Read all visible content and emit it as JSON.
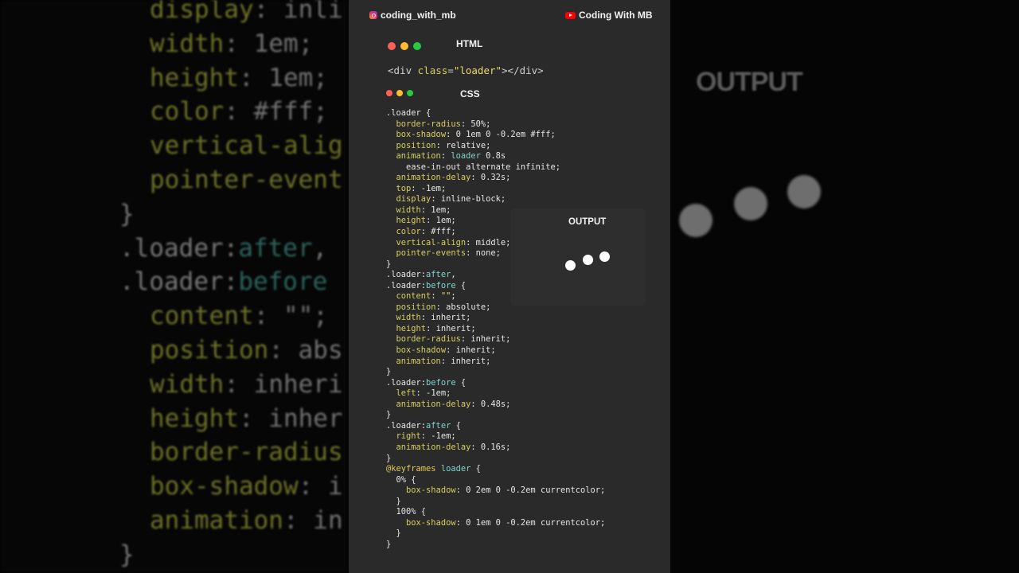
{
  "background_code_left": [
    {
      "prop": "display",
      "val": ": inli"
    },
    {
      "prop": "width",
      "val": ": 1em;"
    },
    {
      "prop": "height",
      "val": ": 1em;"
    },
    {
      "prop": "color",
      "val": ": #fff;"
    },
    {
      "prop": "vertical-alig",
      "val": ""
    },
    {
      "prop": "pointer-event",
      "val": ""
    },
    {
      "plain": "}"
    },
    {
      "sel": ".loader:",
      "pseudo": "after",
      "tail": ","
    },
    {
      "sel": ".loader:",
      "pseudo": "before",
      "tail": ""
    },
    {
      "prop": "content",
      "val": ": \"\";"
    },
    {
      "prop": "position",
      "val": ": abs"
    },
    {
      "prop": "width",
      "val": ": inheri"
    },
    {
      "prop": "height",
      "val": ": inher"
    },
    {
      "prop": "border-radius",
      "val": ""
    },
    {
      "prop": "box-shadow",
      "val": ": i"
    },
    {
      "prop": "animation",
      "val": ": in"
    },
    {
      "plain": "}"
    }
  ],
  "background_right": {
    "output_label": "OUTPUT"
  },
  "header": {
    "instagram_handle": "coding_with_mb",
    "youtube_channel": "Coding With MB"
  },
  "html_section": {
    "title": "HTML",
    "code": {
      "open": "<div ",
      "attr": "class",
      "eq": "=",
      "value": "\"loader\"",
      "close": "></div>"
    }
  },
  "css_section": {
    "title": "CSS",
    "lines": [
      {
        "indent": 0,
        "sel": ".loader",
        "tail": " {"
      },
      {
        "indent": 1,
        "prop": "border-radius",
        "val": ": 50%;"
      },
      {
        "indent": 1,
        "prop": "box-shadow",
        "val": ": 0 1em 0 -0.2em #fff;"
      },
      {
        "indent": 1,
        "prop": "position",
        "val": ": relative;"
      },
      {
        "indent": 1,
        "prop": "animation",
        "val": ": ",
        "valsel": "loader",
        "val2": " 0.8s"
      },
      {
        "indent": 2,
        "plain": "ease-in-out alternate infinite;"
      },
      {
        "indent": 1,
        "prop": "animation-delay",
        "val": ": 0.32s;"
      },
      {
        "indent": 1,
        "prop": "top",
        "val": ": -1em;"
      },
      {
        "indent": 1,
        "prop": "display",
        "val": ": inline-block;"
      },
      {
        "indent": 1,
        "prop": "width",
        "val": ": 1em;"
      },
      {
        "indent": 1,
        "prop": "height",
        "val": ": 1em;"
      },
      {
        "indent": 1,
        "prop": "color",
        "val": ": #fff;"
      },
      {
        "indent": 1,
        "prop": "vertical-align",
        "val": ": middle;"
      },
      {
        "indent": 1,
        "prop": "pointer-events",
        "val": ": none;"
      },
      {
        "indent": 0,
        "plain": "}"
      },
      {
        "indent": 0,
        "sel": ".loader:",
        "pseudo": "after",
        "tail": ","
      },
      {
        "indent": 0,
        "sel": ".loader:",
        "pseudo": "before",
        "tail": " {"
      },
      {
        "indent": 1,
        "prop": "content",
        "val": ": ",
        "valstr": "\"\"",
        "val2": ";"
      },
      {
        "indent": 1,
        "prop": "position",
        "val": ": absolute;"
      },
      {
        "indent": 1,
        "prop": "width",
        "val": ": inherit;"
      },
      {
        "indent": 1,
        "prop": "height",
        "val": ": inherit;"
      },
      {
        "indent": 1,
        "prop": "border-radius",
        "val": ": inherit;"
      },
      {
        "indent": 1,
        "prop": "box-shadow",
        "val": ": inherit;"
      },
      {
        "indent": 1,
        "prop": "animation",
        "val": ": inherit;"
      },
      {
        "indent": 0,
        "plain": "}"
      },
      {
        "indent": 0,
        "sel": ".loader:",
        "pseudo": "before",
        "tail": " {"
      },
      {
        "indent": 1,
        "prop": "left",
        "val": ": -1em;"
      },
      {
        "indent": 1,
        "prop": "animation-delay",
        "val": ": 0.48s;"
      },
      {
        "indent": 0,
        "plain": "}"
      },
      {
        "indent": 0,
        "sel": ".loader:",
        "pseudo": "after",
        "tail": " {"
      },
      {
        "indent": 1,
        "prop": "right",
        "val": ": -1em;"
      },
      {
        "indent": 1,
        "prop": "animation-delay",
        "val": ": 0.16s;"
      },
      {
        "indent": 0,
        "plain": "}"
      },
      {
        "indent": 0,
        "at": "@keyframes",
        "atname": " loader",
        "tail": " {"
      },
      {
        "indent": 1,
        "plain": "0% {"
      },
      {
        "indent": 2,
        "prop": "box-shadow",
        "val": ": 0 2em 0 -0.2em currentcolor;"
      },
      {
        "indent": 1,
        "plain": "}"
      },
      {
        "indent": 1,
        "plain": "100% {"
      },
      {
        "indent": 2,
        "prop": "box-shadow",
        "val": ": 0 1em 0 -0.2em currentcolor;"
      },
      {
        "indent": 1,
        "plain": "}"
      },
      {
        "indent": 0,
        "plain": "}"
      }
    ]
  },
  "output_section": {
    "title": "OUTPUT"
  },
  "colors": {
    "panel_bg": "#2a2a2b",
    "property": "#d6cf5e",
    "selector": "#7fd4c8",
    "traffic_red": "#ff5f57",
    "traffic_yellow": "#febc2e",
    "traffic_green": "#28c840"
  },
  "icons": {
    "instagram": "instagram-icon",
    "youtube": "youtube-icon"
  }
}
